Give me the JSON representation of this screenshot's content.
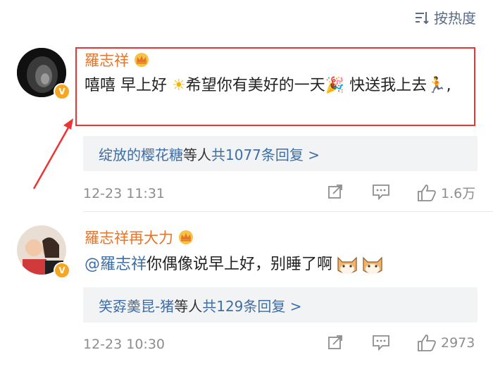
{
  "sort": {
    "label": "按热度"
  },
  "comments": [
    {
      "author": "羅志祥",
      "text_parts": [
        "嘻嘻 早上好 ",
        "☀",
        "希望你有美好的一天",
        "🎉",
        " 快送我上去",
        "🏃",
        ","
      ],
      "reply_names": "绽放的樱花糖",
      "reply_mid": "等人 ",
      "reply_count": "共1077条回复 >",
      "time": "12-23 11:31",
      "likes": "1.6万"
    },
    {
      "author": "羅志祥再大力",
      "mention": "@羅志祥",
      "text": " 你偶像说早上好，别睡了啊",
      "reply_names": "笑孬羮昆-猪",
      "reply_mid": "等人 ",
      "reply_count": "共129条回复 >",
      "time": "12-23 10:30",
      "likes": "2973"
    }
  ],
  "colors": {
    "accent": "#e8742a",
    "link": "#3d6ea6",
    "highlight": "#e33333"
  }
}
